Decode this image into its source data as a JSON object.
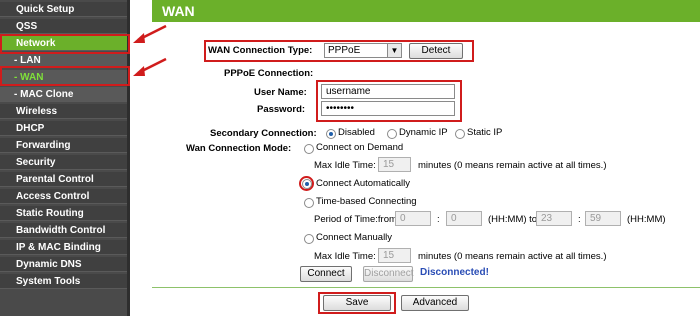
{
  "sidebar": {
    "items": [
      {
        "label": "Quick Setup"
      },
      {
        "label": "QSS"
      },
      {
        "label": "Network"
      },
      {
        "label": "- LAN"
      },
      {
        "label": "- WAN"
      },
      {
        "label": "- MAC Clone"
      },
      {
        "label": "Wireless"
      },
      {
        "label": "DHCP"
      },
      {
        "label": "Forwarding"
      },
      {
        "label": "Security"
      },
      {
        "label": "Parental Control"
      },
      {
        "label": "Access Control"
      },
      {
        "label": "Static Routing"
      },
      {
        "label": "Bandwidth Control"
      },
      {
        "label": "IP & MAC Binding"
      },
      {
        "label": "Dynamic DNS"
      },
      {
        "label": "System Tools"
      }
    ]
  },
  "page": {
    "title": "WAN",
    "wan_type_label": "WAN Connection Type:",
    "wan_type_value": "PPPoE",
    "detect_label": "Detect",
    "pppoe_label": "PPPoE Connection:",
    "username_label": "User Name:",
    "username_value": "username",
    "password_label": "Password:",
    "password_value": "••••••••",
    "secondary_label": "Secondary Connection:",
    "secondary_options": [
      "Disabled",
      "Dynamic IP",
      "Static IP"
    ],
    "mode_label": "Wan Connection Mode:",
    "connect_on_demand": "Connect on Demand",
    "max_idle_label": "Max Idle Time:",
    "max_idle_value_1": "15",
    "max_idle_note": "minutes (0 means remain active at all times.)",
    "connect_auto": "Connect Automatically",
    "time_based": "Time-based Connecting",
    "period_label": "Period of Time:from",
    "period_from_h": "0",
    "period_from_m": "0",
    "hhmm_1": "(HH:MM) to",
    "period_to_h": "23",
    "period_to_m": "59",
    "hhmm_2": "(HH:MM)",
    "connect_manually": "Connect Manually",
    "max_idle_value_2": "15",
    "connect_btn": "Connect",
    "disconnect_btn": "Disconnect",
    "status": "Disconnected!",
    "save_btn": "Save",
    "advanced_btn": "Advanced"
  },
  "colors": {
    "accent_green": "#6bb02a",
    "annotation_red": "#d01c1c",
    "status_blue": "#2a4db5"
  }
}
